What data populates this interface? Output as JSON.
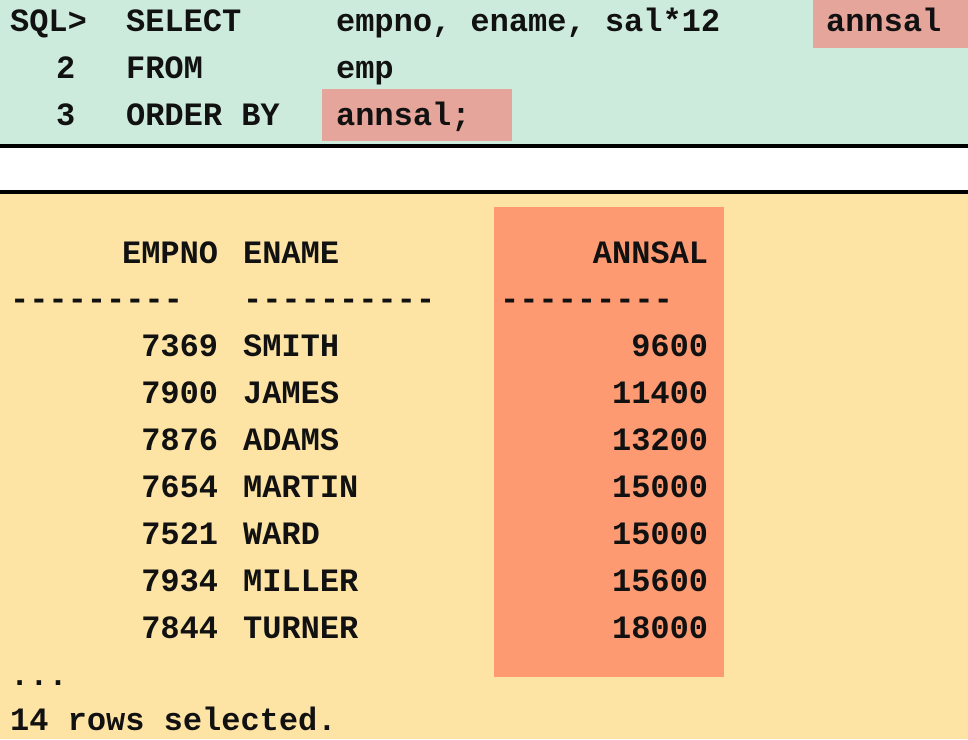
{
  "sql": {
    "prompt": "SQL>",
    "line1_kw": "SELECT",
    "line1_cols": "empno, ename, sal*12",
    "line1_alias": "annsal",
    "line2_num": "2",
    "line2_kw": "FROM",
    "line2_val": "emp",
    "line3_num": "3",
    "line3_kw": "ORDER BY",
    "line3_val": "annsal;"
  },
  "result": {
    "headers": {
      "empno": "EMPNO",
      "ename": "ENAME",
      "annsal": "ANNSAL"
    },
    "dashes": {
      "empno": "---------",
      "ename": "----------",
      "annsal": "---------"
    },
    "rows": [
      {
        "empno": "7369",
        "ename": "SMITH",
        "annsal": "9600"
      },
      {
        "empno": "7900",
        "ename": "JAMES",
        "annsal": "11400"
      },
      {
        "empno": "7876",
        "ename": "ADAMS",
        "annsal": "13200"
      },
      {
        "empno": "7654",
        "ename": "MARTIN",
        "annsal": "15000"
      },
      {
        "empno": "7521",
        "ename": "WARD",
        "annsal": "15000"
      },
      {
        "empno": "7934",
        "ename": "MILLER",
        "annsal": "15600"
      },
      {
        "empno": "7844",
        "ename": "TURNER",
        "annsal": "18000"
      }
    ],
    "ellipsis": "...",
    "footer": "14 rows selected."
  }
}
